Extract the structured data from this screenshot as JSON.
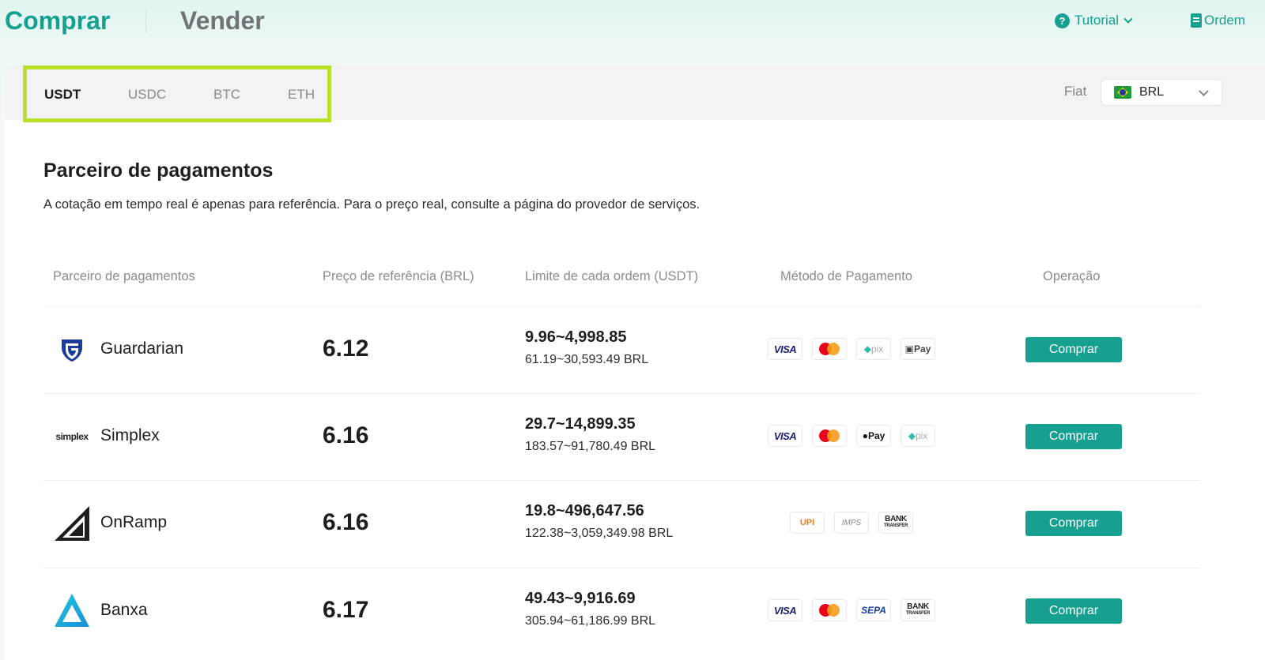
{
  "header": {
    "tabs": [
      "Comprar",
      "Vender"
    ],
    "tutorial": "Tutorial",
    "order": "Ordem"
  },
  "coins": [
    "USDT",
    "USDC",
    "BTC",
    "ETH"
  ],
  "fiat": {
    "label": "Fiat",
    "value": "BRL"
  },
  "section": {
    "title": "Parceiro de pagamentos",
    "description": "A cotação em tempo real é apenas para referência. Para o preço real, consulte a página do provedor de serviços."
  },
  "columns": [
    "Parceiro de pagamentos",
    "Preço de referência (BRL)",
    "Limite de cada ordem (USDT)",
    "Método de Pagamento",
    "Operação"
  ],
  "rows": [
    {
      "name": "Guardarian",
      "price": "6.12",
      "limit": "9.96~4,998.85",
      "limit_fiat": "61.19~30,593.49 BRL",
      "action": "Comprar",
      "methods": [
        "VISA",
        "",
        "pix",
        "Pay"
      ]
    },
    {
      "name": "Simplex",
      "price": "6.16",
      "limit": "29.7~14,899.35",
      "limit_fiat": "183.57~91,780.49 BRL",
      "action": "Comprar",
      "methods": [
        "VISA",
        "",
        "Pay",
        "pix"
      ]
    },
    {
      "name": "OnRamp",
      "price": "6.16",
      "limit": "19.8~496,647.56",
      "limit_fiat": "122.38~3,059,349.98 BRL",
      "action": "Comprar",
      "methods": [
        "UPI",
        "IMPS",
        "BANK"
      ]
    },
    {
      "name": "Banxa",
      "price": "6.17",
      "limit": "49.43~9,916.69",
      "limit_fiat": "305.94~61,186.99 BRL",
      "action": "Comprar",
      "methods": [
        "VISA",
        "",
        "SEPA",
        "BANK"
      ]
    }
  ],
  "logo_text": {
    "simplex": "simplex"
  },
  "bank_sub": "TRANSFER",
  "colors": {
    "accent": "#16a08f",
    "highlight": "#b9e12a"
  }
}
